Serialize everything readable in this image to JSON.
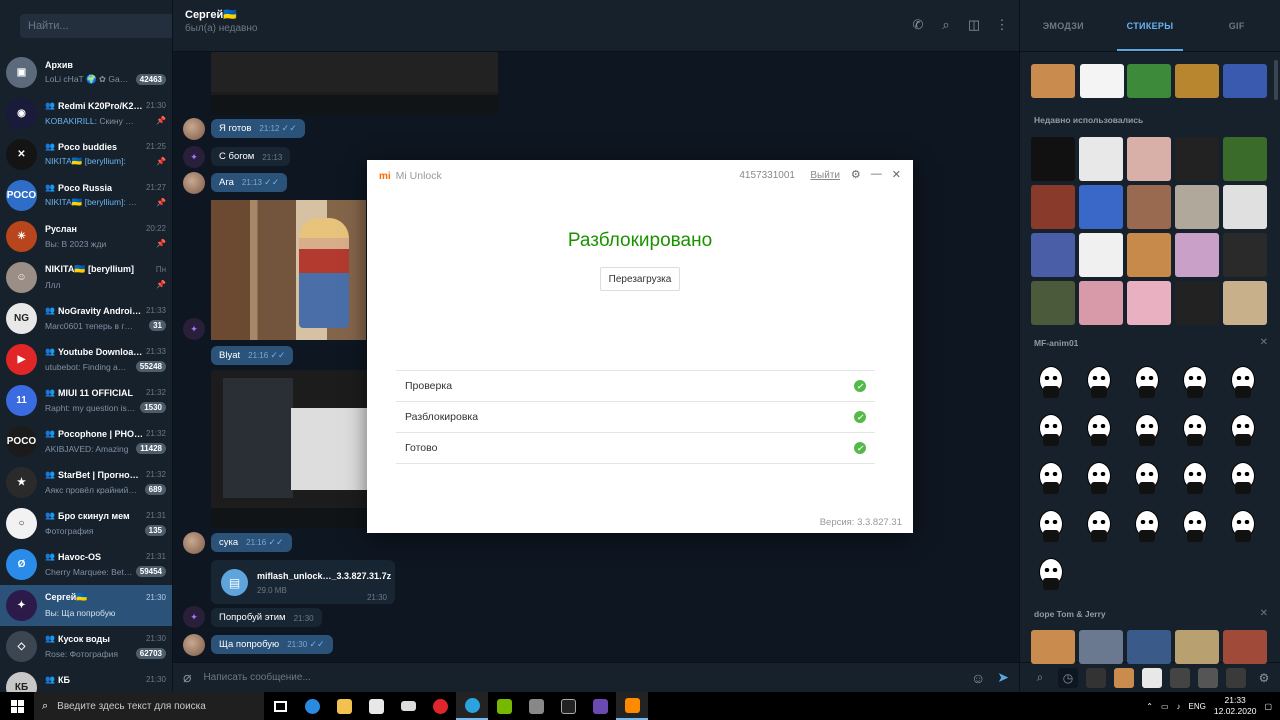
{
  "sidebar": {
    "search_placeholder": "Найти...",
    "chats": [
      {
        "name": "Архив",
        "preview_author": "",
        "preview": "LoLi cHaT 🌍 ✿ Ga…",
        "time": "",
        "badge": "42463",
        "group": false,
        "avatar_color": "#5b6b7c",
        "avatar_text": "▣"
      },
      {
        "name": "Redmi K20Pro/K2…",
        "preview_author": "KOBAKIRILL:",
        "preview": " Скину ссы…",
        "time": "21:30",
        "badge": "",
        "group": true,
        "avatar_color": "#1a1a3a",
        "avatar_text": "◉"
      },
      {
        "name": "Poco buddies",
        "preview_author": "NIKITA🇺🇦 [beryllium]:",
        "preview": "",
        "time": "21:25",
        "badge": "",
        "group": true,
        "avatar_color": "#141414",
        "avatar_text": "✕"
      },
      {
        "name": "Poco Russia",
        "preview_author": "NIKITA🇺🇦 [beryllium]:",
        "preview": " Пр…",
        "time": "21:27",
        "badge": "",
        "group": true,
        "avatar_color": "#2f6ec8",
        "avatar_text": "POCO"
      },
      {
        "name": "Руслан",
        "preview_author": "",
        "preview": "Вы: В 2023 жди",
        "time": "20:22",
        "badge": "",
        "group": false,
        "avatar_color": "#b8451b",
        "avatar_text": "☀"
      },
      {
        "name": "NIKITA🇺🇦 [beryllium]",
        "preview_author": "",
        "preview": "Ллл",
        "time": "Пн",
        "badge": "",
        "group": false,
        "avatar_color": "#9a8e86",
        "avatar_text": "☺"
      },
      {
        "name": "NoGravity Androi…",
        "preview_author": "",
        "preview": "Marc0601 теперь в гру…",
        "time": "21:33",
        "badge": "31",
        "group": true,
        "avatar_color": "#e8e8e8",
        "avatar_text": "NG"
      },
      {
        "name": "Youtube Downloa…",
        "preview_author": "",
        "preview": "utubebot: Finding a…",
        "time": "21:33",
        "badge": "55248",
        "group": true,
        "avatar_color": "#e02626",
        "avatar_text": "▶"
      },
      {
        "name": "MIUI 11 OFFICIAL",
        "preview_author": "",
        "preview": "Rapht: my question is…",
        "time": "21:32",
        "badge": "1530",
        "group": true,
        "avatar_color": "#3a6be0",
        "avatar_text": "11"
      },
      {
        "name": "Pocophone | PHO…",
        "preview_author": "",
        "preview": "AKIBJAVED: Amazing",
        "time": "21:32",
        "badge": "11428",
        "group": true,
        "avatar_color": "#1b1b1b",
        "avatar_text": "POCO"
      },
      {
        "name": "StarBet | Прогно…",
        "preview_author": "",
        "preview": "Аякс провёл крайний …",
        "time": "21:32",
        "badge": "689",
        "group": true,
        "avatar_color": "#2a2a2a",
        "avatar_text": "★"
      },
      {
        "name": "Бро скинул мем",
        "preview_author": "",
        "preview": "Фотография",
        "time": "21:31",
        "badge": "135",
        "group": true,
        "avatar_color": "#f2f2f2",
        "avatar_text": "○"
      },
      {
        "name": "Havoc-OS",
        "preview_author": "",
        "preview": "Cherry Marquee: Bet…",
        "time": "21:31",
        "badge": "59454",
        "group": true,
        "avatar_color": "#2a8be8",
        "avatar_text": "Ø"
      },
      {
        "name": "Сергей🇺🇦",
        "preview_author": "",
        "preview": "Вы: Ща попробую",
        "time": "21:30",
        "badge": "",
        "group": false,
        "avatar_color": "#2b1a4a",
        "avatar_text": "✦",
        "active": true
      },
      {
        "name": "Кусок воды",
        "preview_author": "",
        "preview": "Rose: Фотография",
        "time": "21:30",
        "badge": "62703",
        "group": true,
        "avatar_color": "#3b4652",
        "avatar_text": "◇"
      },
      {
        "name": "КБ",
        "preview_author": "",
        "preview": "",
        "time": "21:30",
        "badge": "",
        "group": true,
        "avatar_color": "#c7c7c7",
        "avatar_text": "КБ"
      }
    ]
  },
  "chat": {
    "title": "Сергей🇺🇦",
    "status": "был(а) недавно",
    "messages": {
      "m1_text": "Я готов",
      "m1_time": "21:12",
      "m2_text": "С богом",
      "m2_time": "21:13",
      "m3_text": "Ага",
      "m3_time": "21:13",
      "m4_text": "Blyat",
      "m4_time": "21:16",
      "m5_text": "сука",
      "m5_time": "21:16",
      "m6_text": "Попробуй этим",
      "m6_time": "21:30",
      "m7_text": "Ща попробую",
      "m7_time": "21:30"
    },
    "file": {
      "name": "miflash_unlock…_3.3.827.31.7z",
      "size": "29.0 MB",
      "time": "21:30"
    },
    "composer_placeholder": "Написать сообщение..."
  },
  "stickers": {
    "tabs": [
      "ЭМОДЗИ",
      "СТИКЕРЫ",
      "GIF"
    ],
    "section_recent": "Недавно использовались",
    "section_pack1": "MF-anim01",
    "section_pack2": "dope Tom & Jerry"
  },
  "modal": {
    "title": "Mi Unlock",
    "logo": "mi",
    "account": "4157331001",
    "logout": "Выйти",
    "heading": "Разблокировано",
    "reboot_label": "Перезагрузка",
    "steps": [
      "Проверка",
      "Разблокировка",
      "Готово"
    ],
    "version": "Версия: 3.3.827.31",
    "success_color": "#1a9200"
  },
  "taskbar": {
    "search_placeholder": "Введите здесь текст для поиска",
    "lang": "ENG",
    "time": "21:33",
    "date": "12.02.2020"
  }
}
